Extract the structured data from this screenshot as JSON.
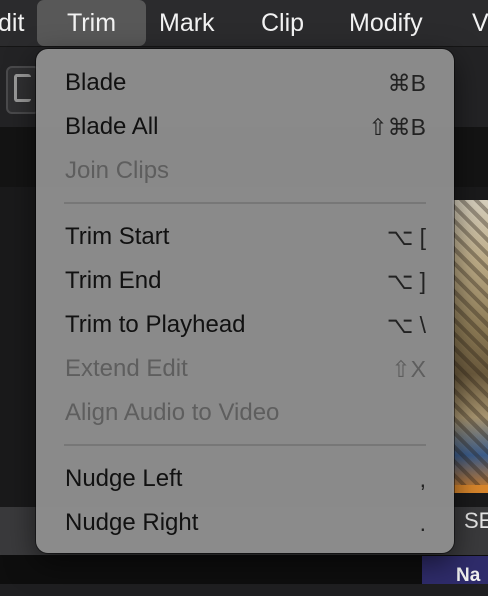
{
  "menubar": {
    "items": [
      {
        "label": "dit"
      },
      {
        "label": "Trim"
      },
      {
        "label": "Mark"
      },
      {
        "label": "Clip"
      },
      {
        "label": "Modify"
      },
      {
        "label": "V"
      }
    ]
  },
  "trim_menu": {
    "items": [
      {
        "label": "Blade",
        "shortcut": "⌘B",
        "enabled": true
      },
      {
        "label": "Blade All",
        "shortcut": "⇧⌘B",
        "enabled": true
      },
      {
        "label": "Join Clips",
        "shortcut": "",
        "enabled": false
      },
      {
        "label": "Trim Start",
        "shortcut": "⌥ [",
        "enabled": true
      },
      {
        "label": "Trim End",
        "shortcut": "⌥ ]",
        "enabled": true
      },
      {
        "label": "Trim to Playhead",
        "shortcut": "⌥ \\",
        "enabled": true
      },
      {
        "label": "Extend Edit",
        "shortcut": "⇧X",
        "enabled": false
      },
      {
        "label": "Align Audio to Video",
        "shortcut": "",
        "enabled": false
      },
      {
        "label": "Nudge Left",
        "shortcut": ",",
        "enabled": true
      },
      {
        "label": "Nudge Right",
        "shortcut": ".",
        "enabled": true
      }
    ]
  },
  "background": {
    "bottom_label": "SE",
    "tab_label": "Na"
  },
  "colors": {
    "menu_bg": "#8f8f8f",
    "menubar_bg": "#2b2b2d",
    "selected_bg": "#585858",
    "tab_bg": "#2f2c6b"
  }
}
